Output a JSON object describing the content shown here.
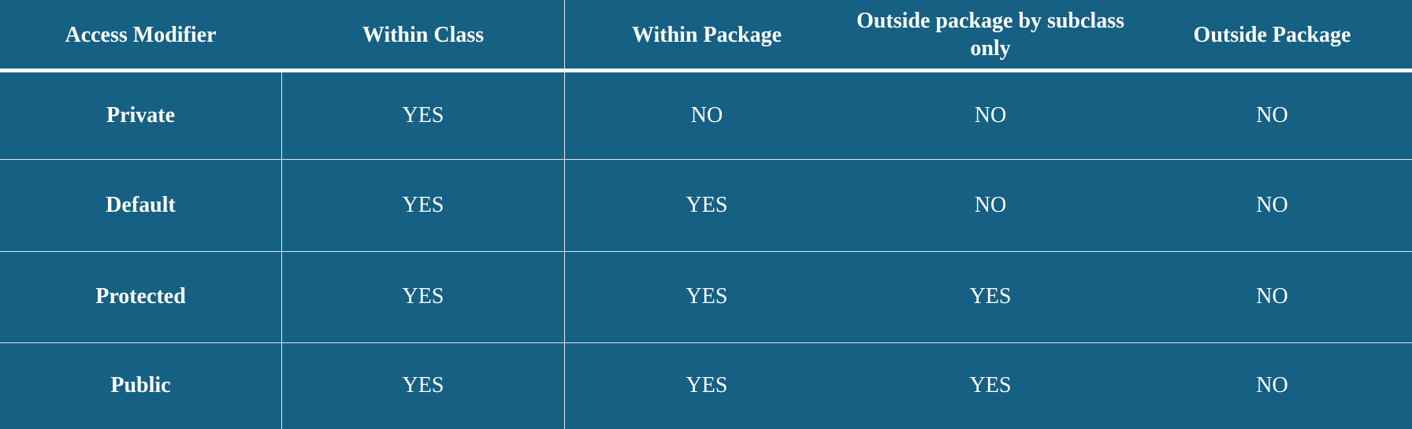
{
  "colors": {
    "background": "#156083",
    "text": "#ffffff",
    "grid": "#dfe9ef"
  },
  "table": {
    "headers": [
      "Access Modifier",
      "Within Class",
      "Within Package",
      "Outside package by subclass only",
      "Outside Package"
    ],
    "rows": [
      {
        "modifier": "Private",
        "values": [
          "YES",
          "NO",
          "NO",
          "NO"
        ]
      },
      {
        "modifier": "Default",
        "values": [
          "YES",
          "YES",
          "NO",
          "NO"
        ]
      },
      {
        "modifier": "Protected",
        "values": [
          "YES",
          "YES",
          "YES",
          "NO"
        ]
      },
      {
        "modifier": "Public",
        "values": [
          "YES",
          "YES",
          "YES",
          "NO"
        ]
      }
    ]
  }
}
